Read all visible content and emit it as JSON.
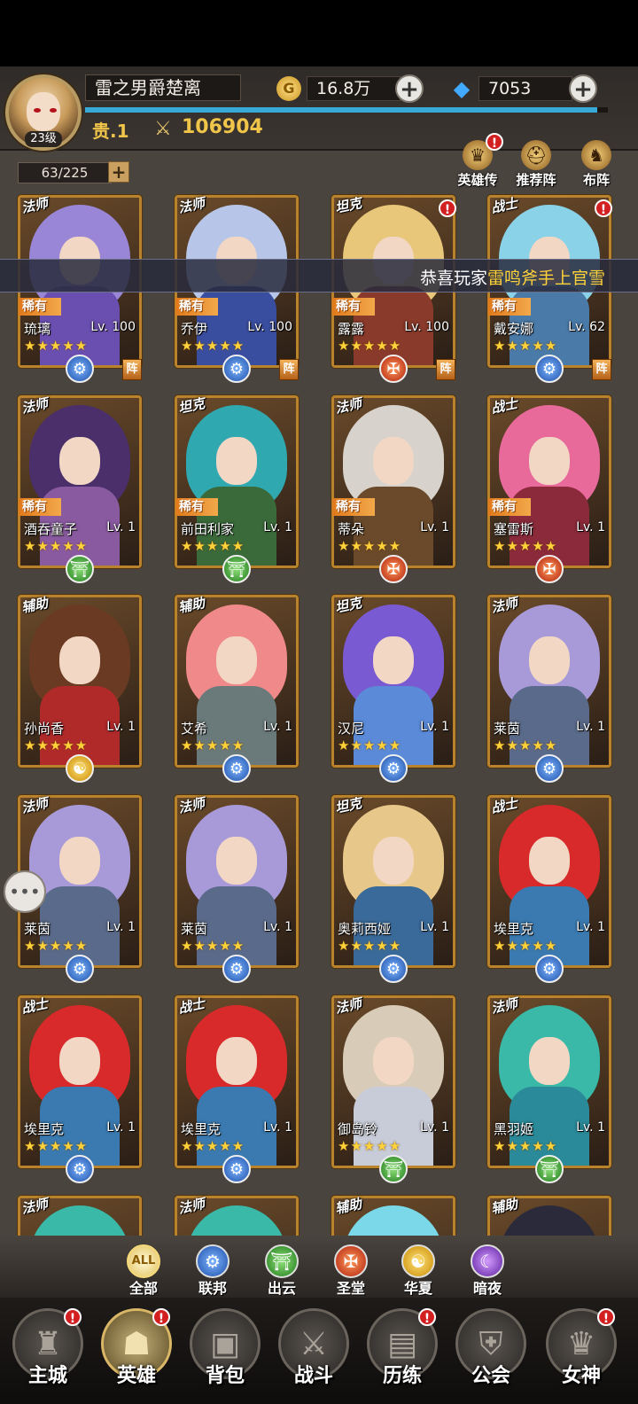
{
  "player": {
    "name": "雷之男爵楚离",
    "level": "23级",
    "noble": "贵.1",
    "power": "106904"
  },
  "currency": {
    "gold": "16.8万",
    "gold_icon": "G",
    "gems": "7053"
  },
  "hero_count": "63/225",
  "top_buttons": [
    {
      "label": "英雄传",
      "icon": "crown-icon",
      "badge": "!"
    },
    {
      "label": "推荐阵",
      "icon": "helmet-icon"
    },
    {
      "label": "布阵",
      "icon": "knight-icon"
    }
  ],
  "ticker": {
    "prefix": "恭喜玩家",
    "highlight": "雷鸣斧手上官雪"
  },
  "zhen_label": "阵",
  "cards": [
    {
      "role": "法师",
      "rarity": "稀有",
      "name": "琉璃",
      "level": "Lv. 100",
      "stars": "★★★★★",
      "faction": "lianbang",
      "zhen": true,
      "hair": "#9a86d6",
      "body": "#6b4fb0"
    },
    {
      "role": "法师",
      "rarity": "稀有",
      "name": "乔伊",
      "level": "Lv. 100",
      "stars": "★★★★★",
      "faction": "lianbang",
      "zhen": true,
      "hair": "#b7c6e8",
      "body": "#3a4ea0"
    },
    {
      "role": "坦克",
      "rarity": "稀有",
      "name": "露露",
      "level": "Lv. 100",
      "stars": "★★★★★",
      "faction": "shengtang",
      "zhen": true,
      "dot": true,
      "hair": "#e8c67a",
      "body": "#8a3a2a"
    },
    {
      "role": "战士",
      "rarity": "稀有",
      "name": "戴安娜",
      "level": "Lv. 62",
      "stars": "★★★★★",
      "faction": "lianbang",
      "zhen": true,
      "dot": true,
      "hair": "#8ad2e8",
      "body": "#4a7aa8"
    },
    {
      "role": "法师",
      "rarity": "稀有",
      "name": "酒吞童子",
      "level": "Lv. 1",
      "stars": "★★★★★",
      "faction": "chuyun",
      "hair": "#4a2f6a",
      "body": "#8a5aa0"
    },
    {
      "role": "坦克",
      "rarity": "稀有",
      "name": "前田利家",
      "level": "Lv. 1",
      "stars": "★★★★★",
      "faction": "chuyun",
      "hair": "#2fa8b0",
      "body": "#3a6a3a"
    },
    {
      "role": "法师",
      "rarity": "稀有",
      "name": "蒂朵",
      "level": "Lv. 1",
      "stars": "★★★★★",
      "faction": "shengtang",
      "hair": "#d8d2cc",
      "body": "#6a4a2a"
    },
    {
      "role": "战士",
      "rarity": "稀有",
      "name": "塞雷斯",
      "level": "Lv. 1",
      "stars": "★★★★★",
      "faction": "shengtang",
      "hair": "#e86a9a",
      "body": "#8a2a3a"
    },
    {
      "role": "辅助",
      "name": "孙尚香",
      "level": "Lv. 1",
      "stars": "★★★★★",
      "faction": "huaxia",
      "hair": "#6a3a22",
      "body": "#b02a2a"
    },
    {
      "role": "辅助",
      "name": "艾希",
      "level": "Lv. 1",
      "stars": "★★★★★",
      "faction": "lianbang",
      "hair": "#f08a8a",
      "body": "#6a7a7a"
    },
    {
      "role": "坦克",
      "name": "汉尼",
      "level": "Lv. 1",
      "stars": "★★★★★",
      "faction": "lianbang",
      "hair": "#7a5ad2",
      "body": "#5a8ad8"
    },
    {
      "role": "法师",
      "name": "莱茵",
      "level": "Lv. 1",
      "stars": "★★★★★",
      "faction": "lianbang",
      "hair": "#a89ad8",
      "body": "#5a6a8a"
    },
    {
      "role": "法师",
      "name": "莱茵",
      "level": "Lv. 1",
      "stars": "★★★★★",
      "faction": "lianbang",
      "hair": "#a89ad8",
      "body": "#5a6a8a"
    },
    {
      "role": "法师",
      "name": "莱茵",
      "level": "Lv. 1",
      "stars": "★★★★★",
      "faction": "lianbang",
      "hair": "#a89ad8",
      "body": "#5a6a8a"
    },
    {
      "role": "坦克",
      "name": "奥莉西娅",
      "level": "Lv. 1",
      "stars": "★★★★★",
      "faction": "lianbang",
      "hair": "#e8c88a",
      "body": "#3a6a9a"
    },
    {
      "role": "战士",
      "name": "埃里克",
      "level": "Lv. 1",
      "stars": "★★★★★",
      "faction": "lianbang",
      "hair": "#d82a2a",
      "body": "#3a7ab0"
    },
    {
      "role": "战士",
      "name": "埃里克",
      "level": "Lv. 1",
      "stars": "★★★★★",
      "faction": "lianbang",
      "hair": "#d82a2a",
      "body": "#3a7ab0"
    },
    {
      "role": "战士",
      "name": "埃里克",
      "level": "Lv. 1",
      "stars": "★★★★★",
      "faction": "lianbang",
      "hair": "#d82a2a",
      "body": "#3a7ab0"
    },
    {
      "role": "法师",
      "name": "御岛铃",
      "level": "Lv. 1",
      "stars": "★★★★★",
      "faction": "chuyun",
      "hair": "#d8ccb8",
      "body": "#c8ccd8"
    },
    {
      "role": "法师",
      "name": "黑羽姬",
      "level": "Lv. 1",
      "stars": "★★★★★",
      "faction": "chuyun",
      "hair": "#3ab8a8",
      "body": "#2a8a9a"
    },
    {
      "role": "法师",
      "hair": "#3ab8a8",
      "body": "#2a8a9a"
    },
    {
      "role": "法师",
      "hair": "#3ab8a8",
      "body": "#2a8a9a"
    },
    {
      "role": "辅助",
      "hair": "#7ad8e8",
      "body": "#4a8aa0"
    },
    {
      "role": "辅助",
      "hair": "#2a2a3a",
      "body": "#4a4a5a"
    }
  ],
  "filters": [
    {
      "key": "all",
      "label": "全部",
      "icon_text": "ALL"
    },
    {
      "key": "lianbang",
      "label": "联邦",
      "icon_text": "⚙"
    },
    {
      "key": "chuyun",
      "label": "出云",
      "icon_text": "⛩"
    },
    {
      "key": "shengtang",
      "label": "圣堂",
      "icon_text": "✠"
    },
    {
      "key": "huaxia",
      "label": "华夏",
      "icon_text": "☯"
    },
    {
      "key": "anye",
      "label": "暗夜",
      "icon_text": "☾"
    }
  ],
  "nav": [
    {
      "label": "主城",
      "icon": "castle-icon",
      "glyph": "♜",
      "badge": "!"
    },
    {
      "label": "英雄",
      "icon": "hood-icon",
      "glyph": "☗",
      "badge": "!",
      "active": true
    },
    {
      "label": "背包",
      "icon": "backpack-icon",
      "glyph": "▣"
    },
    {
      "label": "战斗",
      "icon": "crossed-swords-icon",
      "glyph": "⚔"
    },
    {
      "label": "历练",
      "icon": "map-icon",
      "glyph": "▤",
      "badge": "!"
    },
    {
      "label": "公会",
      "icon": "shield-icon",
      "glyph": "⛨"
    },
    {
      "label": "女神",
      "icon": "goddess-icon",
      "glyph": "♛",
      "badge": "!"
    }
  ],
  "colors": {
    "accent": "#f0c54a",
    "xp_bar": "#38a8d6",
    "badge": "#d21f1f",
    "card_border": "#b9832d"
  }
}
